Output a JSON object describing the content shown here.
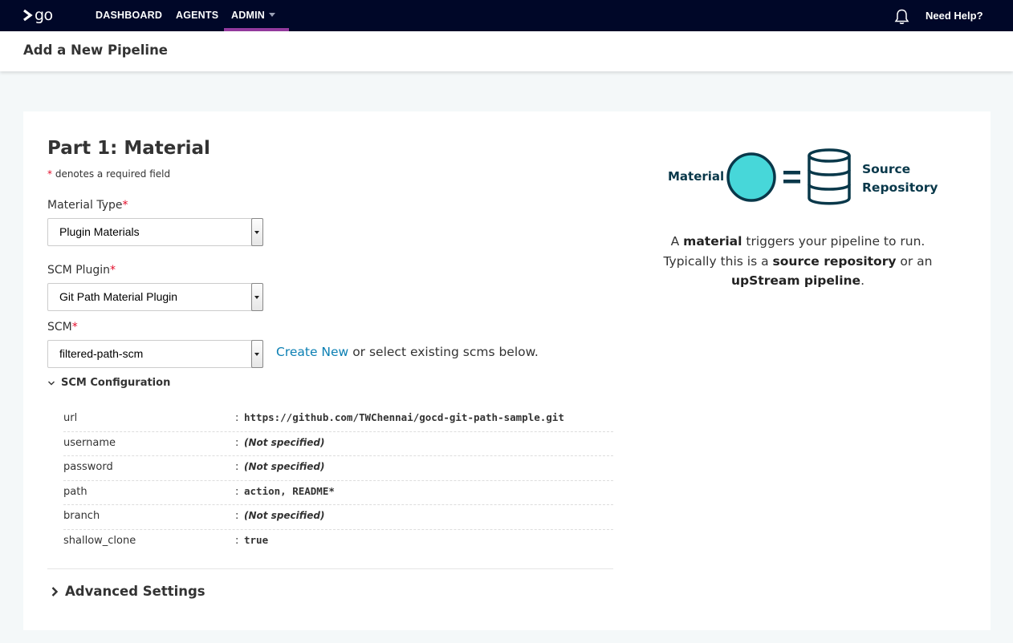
{
  "nav": {
    "logo_text": "go",
    "items": [
      {
        "label": "DASHBOARD"
      },
      {
        "label": "AGENTS"
      },
      {
        "label": "ADMIN"
      }
    ],
    "help_label": "Need Help?",
    "active_color": "#943a9e"
  },
  "page": {
    "title": "Add a New Pipeline"
  },
  "form": {
    "part_title": "Part 1: Material",
    "required_star": "*",
    "required_note": "denotes a required field",
    "material_type": {
      "label": "Material Type",
      "value": "Plugin Materials"
    },
    "scm_plugin": {
      "label": "SCM Plugin",
      "value": "Git Path Material Plugin"
    },
    "scm": {
      "label": "SCM",
      "value": "filtered-path-scm"
    },
    "create_new_link": "Create New",
    "create_new_suffix": "or select existing scms below.",
    "scm_config_label": "SCM Configuration",
    "config_separator": ":",
    "config_rows": [
      {
        "key": "url",
        "value": "https://github.com/TWChennai/gocd-git-path-sample.git"
      },
      {
        "key": "username",
        "value": "(Not specified)"
      },
      {
        "key": "password",
        "value": "(Not specified)"
      },
      {
        "key": "path",
        "value": "action, README*"
      },
      {
        "key": "branch",
        "value": "(Not specified)"
      },
      {
        "key": "shallow_clone",
        "value": "true"
      }
    ],
    "advanced_label": "Advanced Settings"
  },
  "illustration": {
    "material_label": "Material",
    "source_line1": "Source",
    "source_line2": "Repository",
    "circle_color": "#47d7d9",
    "stroke_color": "#09384a"
  },
  "description": {
    "p1": "A ",
    "b1": "material",
    "p2": " triggers your pipeline to run. Typically this is a ",
    "b2": "source repository",
    "p3": " or an ",
    "b3": "upStream pipeline",
    "p4": "."
  }
}
